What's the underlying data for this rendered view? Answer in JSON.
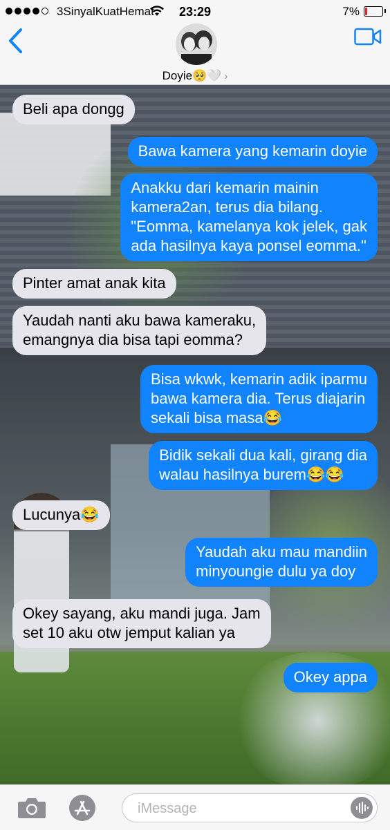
{
  "status_bar": {
    "carrier": "3SinyalKuatHemat",
    "time": "23:29",
    "battery_percent": "7%"
  },
  "header": {
    "contact_name": "Doyie🥺🤍",
    "chevron": "›"
  },
  "messages": [
    {
      "side": "in",
      "lines": [
        "Beli apa dongg"
      ]
    },
    {
      "side": "out",
      "lines": [
        "Bawa kamera yang kemarin doyie"
      ]
    },
    {
      "side": "out",
      "lines": [
        "Anakku dari kemarin mainin",
        "kamera2an, terus dia bilang.",
        "\"Eomma, kamelanya kok jelek, gak",
        "ada hasilnya kaya ponsel eomma.\""
      ]
    },
    {
      "side": "in",
      "lines": [
        "Pinter amat anak kita"
      ]
    },
    {
      "side": "in",
      "lines": [
        "Yaudah nanti aku bawa kameraku,",
        "emangnya dia bisa tapi eomma?"
      ]
    },
    {
      "side": "out",
      "lines": [
        "Bisa wkwk, kemarin adik iparmu",
        "bawa kamera dia. Terus diajarin",
        "sekali bisa masa😂"
      ]
    },
    {
      "side": "out",
      "lines": [
        "Bidik sekali dua kali, girang dia",
        "walau hasilnya burem😂😂"
      ]
    },
    {
      "side": "in",
      "lines": [
        "Lucunya😂"
      ]
    },
    {
      "side": "out",
      "lines": [
        "Yaudah aku mau mandiin",
        "minyoungie dulu ya doy"
      ]
    },
    {
      "side": "in",
      "lines": [
        "Okey sayang, aku mandi juga. Jam",
        "set 10 aku otw jemput kalian ya"
      ]
    },
    {
      "side": "out",
      "lines": [
        "Okey appa"
      ]
    }
  ],
  "composer": {
    "placeholder": "iMessage"
  },
  "icons": {
    "back": "chevron-left-icon",
    "video": "video-camera-icon",
    "camera": "camera-icon",
    "apps": "app-store-icon",
    "audio": "audio-waveform-icon",
    "wifi": "wifi-icon",
    "battery": "battery-icon"
  },
  "colors": {
    "accent": "#1183fd",
    "incoming_bubble": "#e6e5eb",
    "bar_background": "#f6f6f7",
    "battery_low": "#e0232e"
  }
}
